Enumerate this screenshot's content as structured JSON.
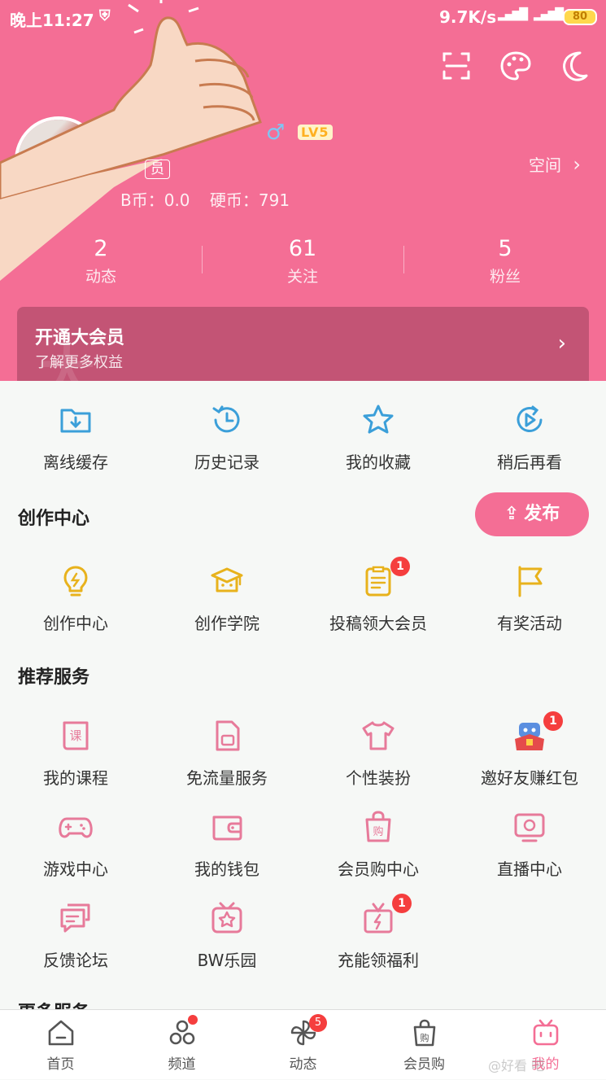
{
  "status_bar": {
    "time": "晚上11:27",
    "net_speed": "9.7K/s",
    "signal_left": "4G",
    "signal_icons": "▂▄▆█",
    "battery": "80"
  },
  "profile": {
    "level": "LV5",
    "vip_tag": "员",
    "bcoin": "B币：0.0",
    "coin": "硬币：791",
    "space_link": "空间",
    "space_arrow": "›"
  },
  "stats": [
    {
      "num": "2",
      "label": "动态"
    },
    {
      "num": "61",
      "label": "关注"
    },
    {
      "num": "5",
      "label": "粉丝"
    }
  ],
  "vip_banner": {
    "title": "开通大会员",
    "subtitle": "了解更多权益",
    "arrow": "›"
  },
  "quick": [
    {
      "label": "离线缓存"
    },
    {
      "label": "历史记录"
    },
    {
      "label": "我的收藏"
    },
    {
      "label": "稍后再看"
    }
  ],
  "creator": {
    "title": "创作中心",
    "publish": "发布",
    "items": [
      {
        "label": "创作中心"
      },
      {
        "label": "创作学院"
      },
      {
        "label": "投稿领大会员",
        "badge": "1"
      },
      {
        "label": "有奖活动"
      }
    ]
  },
  "services": {
    "title": "推荐服务",
    "items": [
      {
        "label": "我的课程"
      },
      {
        "label": "免流量服务"
      },
      {
        "label": "个性装扮"
      },
      {
        "label": "邀好友赚红包",
        "badge": "1"
      },
      {
        "label": "游戏中心"
      },
      {
        "label": "我的钱包"
      },
      {
        "label": "会员购中心"
      },
      {
        "label": "直播中心"
      },
      {
        "label": "反馈论坛"
      },
      {
        "label": "BW乐园"
      },
      {
        "label": "充能领福利",
        "badge": "1"
      }
    ]
  },
  "more": {
    "title": "更多服务"
  },
  "tabs": [
    {
      "label": "首页"
    },
    {
      "label": "频道"
    },
    {
      "label": "动态",
      "badge": "5"
    },
    {
      "label": "会员购"
    },
    {
      "label": "我的"
    }
  ],
  "colors": {
    "brand_pink": "#f46e95",
    "banner": "#c35475",
    "icon_blue": "#3b9fd9",
    "icon_yellow": "#e8b21c",
    "icon_pink": "#e77a9a",
    "badge_red": "#f53e3e"
  },
  "watermark": "@好看 吧"
}
